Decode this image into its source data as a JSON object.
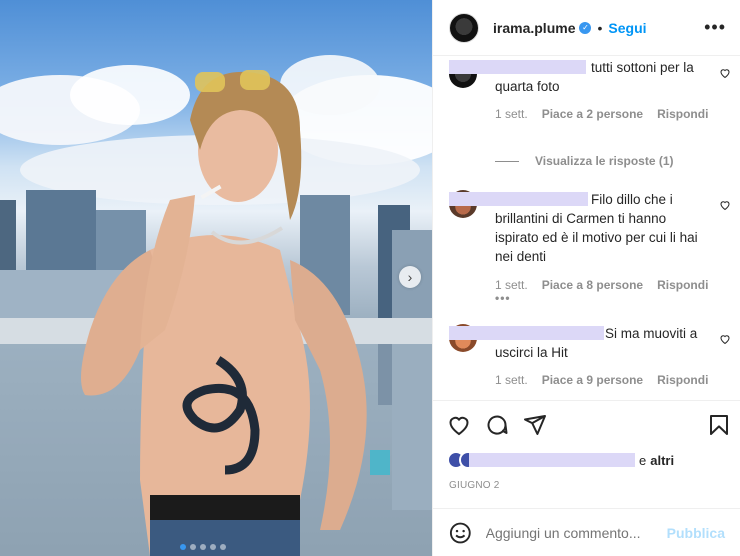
{
  "post": {
    "username": "irama.plume",
    "separator": "•",
    "follow_label": "Segui",
    "more_label": "•••"
  },
  "comments": [
    {
      "text": "tutti sottoni per la quarta foto",
      "time": "1 sett.",
      "likes": "Piace a 2 persone",
      "reply": "Rispondi",
      "view_replies": "Visualizza le risposte (1)"
    },
    {
      "text": "Filo dillo che i brillantini di Carmen ti hanno ispirato ed è il motivo per cui li hai nei denti",
      "time": "1 sett.",
      "likes": "Piace a 8 persone",
      "reply": "Rispondi",
      "more": "•••"
    },
    {
      "text": "Si ma muoviti a uscirci la Hit",
      "time": "1 sett.",
      "likes": "Piace a 9 persone",
      "reply": "Rispondi"
    }
  ],
  "likes_line": {
    "conj": "e",
    "others": "altri"
  },
  "date": "GIUGNO 2",
  "add_comment": {
    "placeholder": "Aggiungi un commento...",
    "publish_label": "Pubblica"
  },
  "icons": [
    "heart-icon",
    "comment-icon",
    "share-icon",
    "bookmark-icon",
    "emoji-icon",
    "next-arrow-icon",
    "verified-icon"
  ]
}
